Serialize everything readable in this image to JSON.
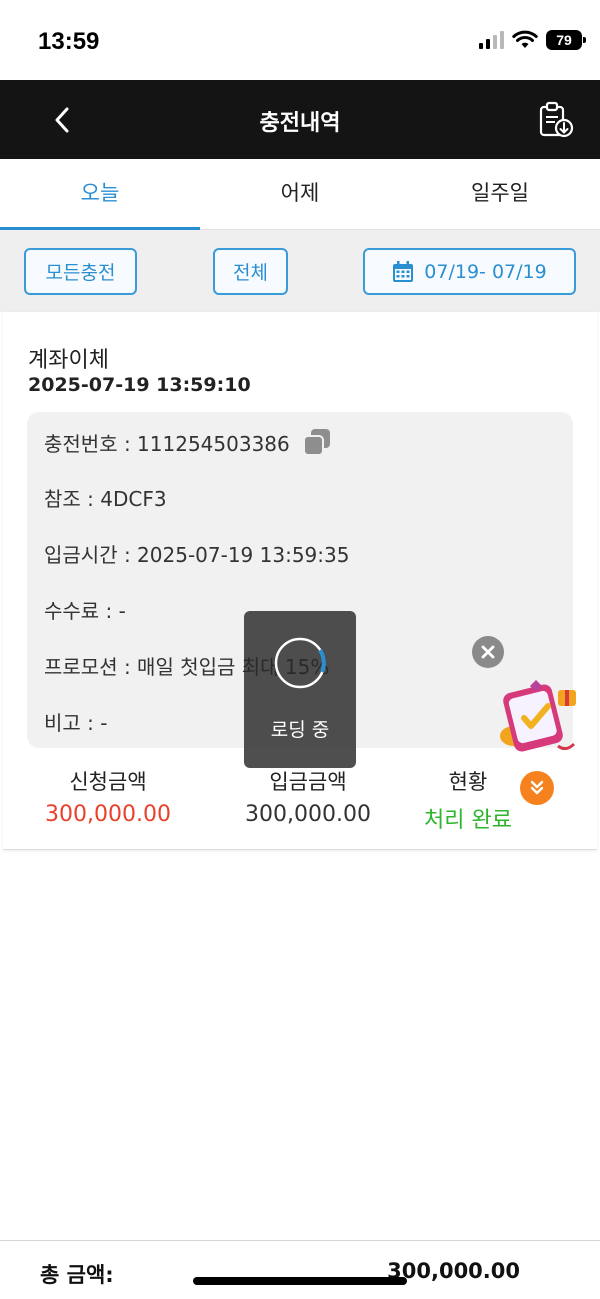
{
  "status_bar": {
    "time": "13:59",
    "battery": "79"
  },
  "header": {
    "title": "충전내역",
    "back_icon": "chevron-left-icon",
    "export_icon": "clipboard-download-icon"
  },
  "tabs": [
    {
      "label": "오늘",
      "active": true
    },
    {
      "label": "어제",
      "active": false
    },
    {
      "label": "일주일",
      "active": false
    }
  ],
  "filters": {
    "type_label": "모든충전",
    "scope_label": "전체",
    "date_range": "07/19- 07/19",
    "date_icon": "calendar-icon"
  },
  "record": {
    "type": "계좌이체",
    "datetime": "2025-07-19 13:59:10",
    "details": [
      {
        "text": "충전번호 : 111254503386"
      },
      {
        "text": "참조 : 4DCF3"
      },
      {
        "text": "입금시간 : 2025-07-19 13:59:35"
      },
      {
        "text": "수수료 : -"
      },
      {
        "text": "프로모션 : 매일 첫입금 최대 15%"
      },
      {
        "text": "비고 : -"
      }
    ],
    "summary": {
      "requested_label": "신청금액",
      "requested_value": "300,000.00",
      "deposited_label": "입금금액",
      "deposited_value": "300,000.00",
      "status_label": "현황",
      "status_value": "처리 완료"
    }
  },
  "loading": {
    "text": "로딩 중"
  },
  "footer": {
    "total_label": "총 금액:",
    "total_value": "300,000.00"
  },
  "colors": {
    "header_bg": "#141414",
    "accent": "#2a8fd0",
    "requested": "#e8412c",
    "status_ok": "#2db52b",
    "expand": "#f5821f"
  }
}
